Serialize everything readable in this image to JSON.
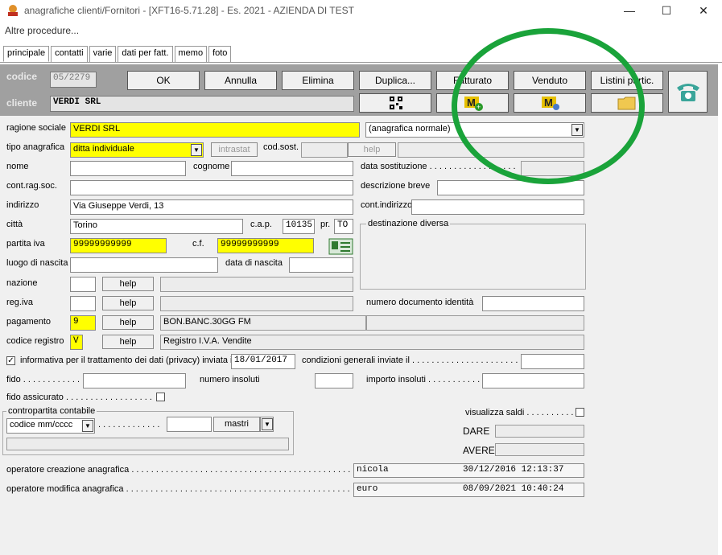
{
  "window": {
    "title": "anagrafiche clienti/Fornitori - [XFT16-5.71.28] - Es. 2021 - AZIENDA DI TEST",
    "minimize": "—",
    "maximize": "☐",
    "close": "✕"
  },
  "menu": {
    "item": "Altre procedure..."
  },
  "tabs": [
    "principale",
    "contatti",
    "varie",
    "dati per fatt.",
    "memo",
    "foto"
  ],
  "header": {
    "codice_label": "codice",
    "codice_value": "05/2279",
    "cliente_label": "cliente",
    "cliente_value": "VERDI SRL",
    "buttons": [
      "OK",
      "Annulla",
      "Elimina",
      "Duplica...",
      "Fatturato",
      "Venduto",
      "Listini partic."
    ]
  },
  "form": {
    "ragione_sociale_label": "ragione sociale",
    "ragione_sociale_value": "VERDI SRL",
    "tipo_anagrafica_select": "(anagrafica normale)",
    "tipo_anagrafica_label": "tipo anagrafica",
    "tipo_anagrafica_value": "ditta individuale",
    "intrastat_button": "intrastat",
    "cod_sost_label": "cod.sost.",
    "help_label": "help",
    "nome_label": "nome",
    "cognome_label": "cognome",
    "data_sostituzione_label": "data sostituzione . . . . . . . . . . . . . . . . . .",
    "cont_rag_soc_label": "cont.rag.soc.",
    "descrizione_breve_label": "descrizione breve",
    "indirizzo_label": "indirizzo",
    "indirizzo_value": "Via Giuseppe Verdi, 13",
    "cont_indirizzo_label": "cont.indirizzo",
    "citta_label": "città",
    "citta_value": "Torino",
    "cap_label": "c.a.p.",
    "cap_value": "10135",
    "pr_label": "pr.",
    "pr_value": "TO",
    "destinazione_label": "destinazione diversa",
    "partita_iva_label": "partita iva",
    "partita_iva_value": "99999999999",
    "cf_label": "c.f.",
    "cf_value": "99999999999",
    "luogo_nascita_label": "luogo di nascita",
    "data_nascita_label": "data di nascita",
    "nazione_label": "nazione",
    "reg_iva_label": "reg.iva",
    "numero_documento_label": "numero documento identità",
    "pagamento_label": "pagamento",
    "pagamento_value": "9",
    "pagamento_desc": "BON.BANC.30GG FM",
    "codice_registro_label": "codice registro",
    "codice_registro_value": "V",
    "codice_registro_desc": "Registro I.V.A. Vendite",
    "privacy_label": "informativa per il trattamento dei dati (privacy) inviata il",
    "privacy_date": "18/01/2017",
    "condizioni_label": "condizioni generali inviate il . . . . . . . . . . . . . . . . . . . . . . . .",
    "fido_label": "fido . . . . . . . . . . . . .",
    "numero_insoluti_label": "numero insoluti",
    "importo_insoluti_label": "importo insoluti . . . . . . . . . . . .",
    "fido_assicurato_label": "fido assicurato . . . . . . . . . . . . . . . . . .",
    "contropartita_label": "contropartita contabile",
    "codice_select": "codice mm/cccc",
    "dots": ". . . . . . . . . . . . .",
    "mastri_label": "mastri",
    "visualizza_saldi_label": "visualizza saldi . . . . . . . . . .",
    "dare_label": "DARE",
    "avere_label": "AVERE",
    "op_creazione_label": "operatore creazione anagrafica . . . . . . . . . . . . . . . . . . . . . . . . . . . . . . . . . . . . . . . . . . . . . . . . . . . . . . . . . . . . . . .",
    "op_creazione_value": "nicola              30/12/2016 12:13:37",
    "op_modifica_label": "operatore modifica anagrafica . . . . . . . . . . . . . . . . . . . . . . . . . . . . . . . . . . . . . . . . . . . . . . . . . . . . . . . . . . . . . . . .",
    "op_modifica_value": "euro                08/09/2021 10:40:24"
  }
}
